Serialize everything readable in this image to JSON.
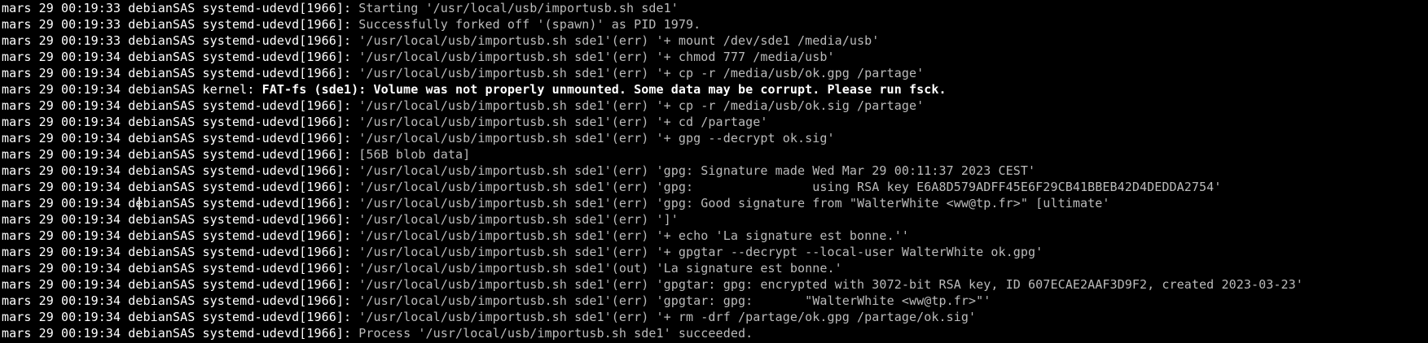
{
  "window": {
    "background": "#000000",
    "prefix_color": "#ffffff",
    "message_color": "#bbbbbb"
  },
  "lines": [
    {
      "prefix": "mars 29 00:19:33 debianSAS systemd-udevd[1966]: ",
      "message": "Starting '/usr/local/usb/importusb.sh sde1'",
      "bold": false
    },
    {
      "prefix": "mars 29 00:19:33 debianSAS systemd-udevd[1966]: ",
      "message": "Successfully forked off '(spawn)' as PID 1979.",
      "bold": false
    },
    {
      "prefix": "mars 29 00:19:33 debianSAS systemd-udevd[1966]: ",
      "message": "'/usr/local/usb/importusb.sh sde1'(err) '+ mount /dev/sde1 /media/usb'",
      "bold": false
    },
    {
      "prefix": "mars 29 00:19:34 debianSAS systemd-udevd[1966]: ",
      "message": "'/usr/local/usb/importusb.sh sde1'(err) '+ chmod 777 /media/usb'",
      "bold": false
    },
    {
      "prefix": "mars 29 00:19:34 debianSAS systemd-udevd[1966]: ",
      "message": "'/usr/local/usb/importusb.sh sde1'(err) '+ cp -r /media/usb/ok.gpg /partage'",
      "bold": false
    },
    {
      "prefix": "mars 29 00:19:34 debianSAS kernel: ",
      "message": "FAT-fs (sde1): Volume was not properly unmounted. Some data may be corrupt. Please run fsck.",
      "bold": true
    },
    {
      "prefix": "mars 29 00:19:34 debianSAS systemd-udevd[1966]: ",
      "message": "'/usr/local/usb/importusb.sh sde1'(err) '+ cp -r /media/usb/ok.sig /partage'",
      "bold": false
    },
    {
      "prefix": "mars 29 00:19:34 debianSAS systemd-udevd[1966]: ",
      "message": "'/usr/local/usb/importusb.sh sde1'(err) '+ cd /partage'",
      "bold": false
    },
    {
      "prefix": "mars 29 00:19:34 debianSAS systemd-udevd[1966]: ",
      "message": "'/usr/local/usb/importusb.sh sde1'(err) '+ gpg --decrypt ok.sig'",
      "bold": false
    },
    {
      "prefix": "mars 29 00:19:34 debianSAS systemd-udevd[1966]: ",
      "message": "[56B blob data]",
      "bold": false
    },
    {
      "prefix": "mars 29 00:19:34 debianSAS systemd-udevd[1966]: ",
      "message": "'/usr/local/usb/importusb.sh sde1'(err) 'gpg: Signature made Wed Mar 29 00:11:37 2023 CEST'",
      "bold": false
    },
    {
      "prefix": "mars 29 00:19:34 debianSAS systemd-udevd[1966]: ",
      "message": "'/usr/local/usb/importusb.sh sde1'(err) 'gpg:                using RSA key E6A8D579ADFF45E6F29CB41BBEB42D4DEDDA2754'",
      "bold": false
    },
    {
      "prefix": "mars 29 00:19:34 debianSAS systemd-udevd[1966]: ",
      "message": "'/usr/local/usb/importusb.sh sde1'(err) 'gpg: Good signature from \"WalterWhite <ww@tp.fr>\" [ultimate'",
      "bold": false
    },
    {
      "prefix": "mars 29 00:19:34 debianSAS systemd-udevd[1966]: ",
      "message": "'/usr/local/usb/importusb.sh sde1'(err) ']'",
      "bold": false
    },
    {
      "prefix": "mars 29 00:19:34 debianSAS systemd-udevd[1966]: ",
      "message": "'/usr/local/usb/importusb.sh sde1'(err) '+ echo 'La signature est bonne.''",
      "bold": false
    },
    {
      "prefix": "mars 29 00:19:34 debianSAS systemd-udevd[1966]: ",
      "message": "'/usr/local/usb/importusb.sh sde1'(err) '+ gpgtar --decrypt --local-user WalterWhite ok.gpg'",
      "bold": false
    },
    {
      "prefix": "mars 29 00:19:34 debianSAS systemd-udevd[1966]: ",
      "message": "'/usr/local/usb/importusb.sh sde1'(out) 'La signature est bonne.'",
      "bold": false
    },
    {
      "prefix": "mars 29 00:19:34 debianSAS systemd-udevd[1966]: ",
      "message": "'/usr/local/usb/importusb.sh sde1'(err) 'gpgtar: gpg: encrypted with 3072-bit RSA key, ID 607ECAE2AAF3D9F2, created 2023-03-23'",
      "bold": false
    },
    {
      "prefix": "mars 29 00:19:34 debianSAS systemd-udevd[1966]: ",
      "message": "'/usr/local/usb/importusb.sh sde1'(err) 'gpgtar: gpg:       \"WalterWhite <ww@tp.fr>\"'",
      "bold": false
    },
    {
      "prefix": "mars 29 00:19:34 debianSAS systemd-udevd[1966]: ",
      "message": "'/usr/local/usb/importusb.sh sde1'(err) '+ rm -drf /partage/ok.gpg /partage/ok.sig'",
      "bold": false
    },
    {
      "prefix": "mars 29 00:19:34 debianSAS systemd-udevd[1966]: ",
      "message": "Process '/usr/local/usb/importusb.sh sde1' succeeded.",
      "bold": false
    }
  ]
}
